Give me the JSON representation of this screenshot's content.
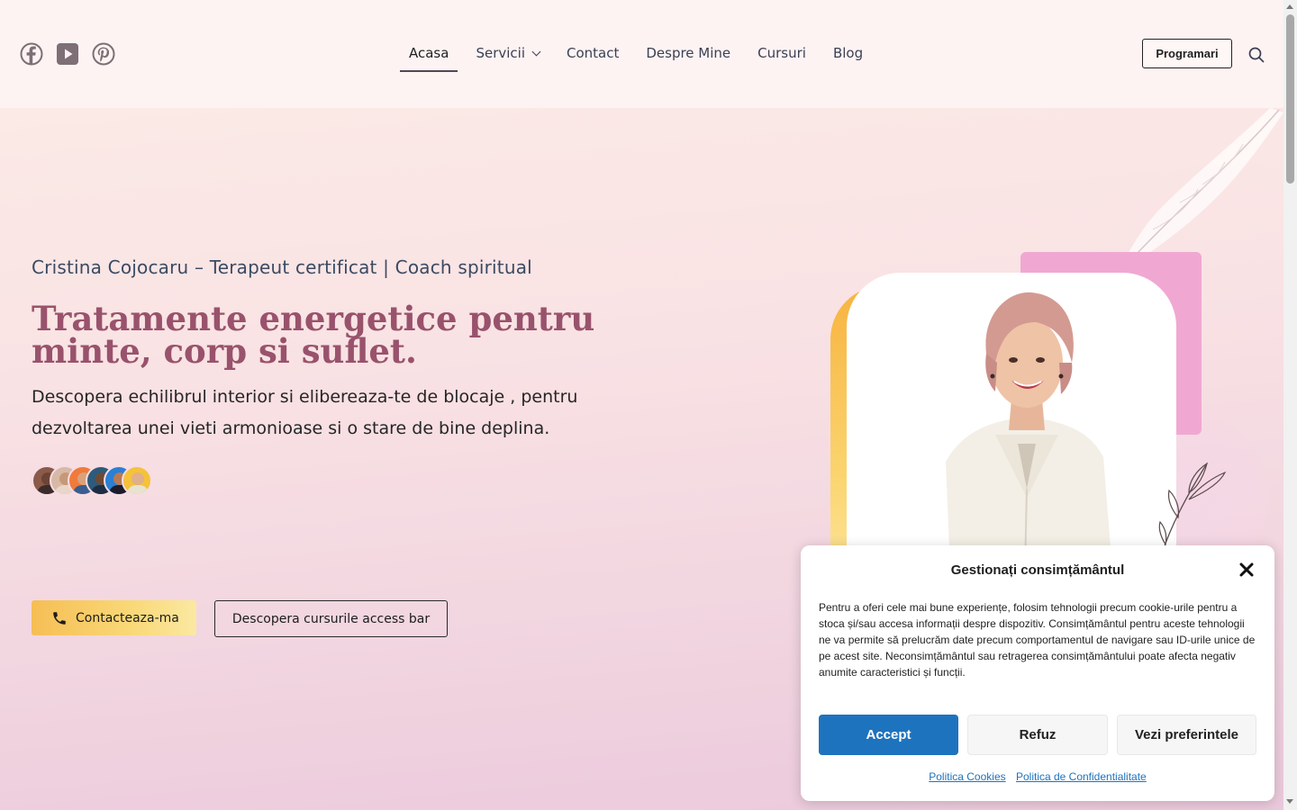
{
  "header": {
    "social": [
      {
        "name": "facebook-icon"
      },
      {
        "name": "youtube-icon"
      },
      {
        "name": "pinterest-icon"
      }
    ],
    "nav": [
      {
        "label": "Acasa",
        "active": true
      },
      {
        "label": "Servicii",
        "dropdown": true
      },
      {
        "label": "Contact"
      },
      {
        "label": "Despre Mine"
      },
      {
        "label": "Cursuri"
      },
      {
        "label": "Blog"
      }
    ],
    "cta_label": "Programari",
    "search_icon": "search-icon"
  },
  "hero": {
    "subtitle": "Cristina Cojocaru  – Terapeut certificat | Coach spiritual",
    "headline": "Tratamente energetice pentru minte, corp si suflet.",
    "description": "Descopera echilibrul interior si elibereaza-te de blocaje , pentru dezvoltarea unei vieti armonioase si o stare de bine deplina.",
    "avatar_count": 6,
    "contact_button": "Contacteaza-ma",
    "courses_button": "Descopera cursurile access bar"
  },
  "cookie_modal": {
    "title": "Gestionați consimțământul",
    "text": "Pentru a oferi cele mai bune experiențe, folosim tehnologii precum cookie-urile pentru a stoca și/sau accesa informații despre dispozitiv. Consimțământul pentru aceste tehnologii ne va permite să prelucrăm date precum comportamentul de navigare sau ID-urile unice de pe acest site. Neconsimțământul sau retragerea consimțământului poate afecta negativ anumite caracteristici și funcții.",
    "accept": "Accept",
    "refuse": "Refuz",
    "preferences": "Vezi preferintele",
    "link_cookies": "Politica Cookies",
    "link_privacy": "Politica de Confidentialitate"
  },
  "colors": {
    "accent_rose": "#99526c",
    "accept_blue": "#1e73be",
    "yellow": "#f6be55",
    "pink": "#f0a8d2"
  }
}
